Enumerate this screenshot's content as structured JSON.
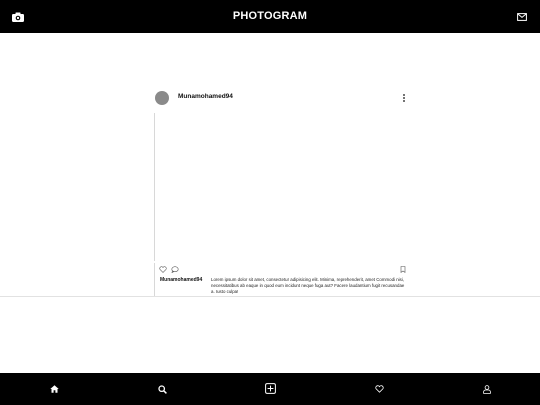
{
  "header": {
    "title": "PHOTOGRAM",
    "left_icon": "camera-icon",
    "right_icon": "mail-icon"
  },
  "post": {
    "username": "Munamohamed94",
    "caption_user": "Munamohamed94",
    "caption_text": "Lorem ipsum dolor sit amet, consectetur adipisicing elit. Minima, reprehenderit, amet Commodi nisi, necessitatibus ab eaque in quod eum incidunt neque fuga aut? Facere laudantium fugit recusandae a. Iusto culpa!",
    "icons": [
      "more-vertical-icon",
      "heart-icon",
      "comment-icon",
      "bookmark-icon"
    ]
  },
  "nav": {
    "items": [
      "home-icon",
      "search-icon",
      "add-icon",
      "heart-icon",
      "profile-icon"
    ]
  },
  "colors": {
    "bar": "#000000",
    "background": "#ffffff",
    "avatar": "#8a8a8a"
  }
}
